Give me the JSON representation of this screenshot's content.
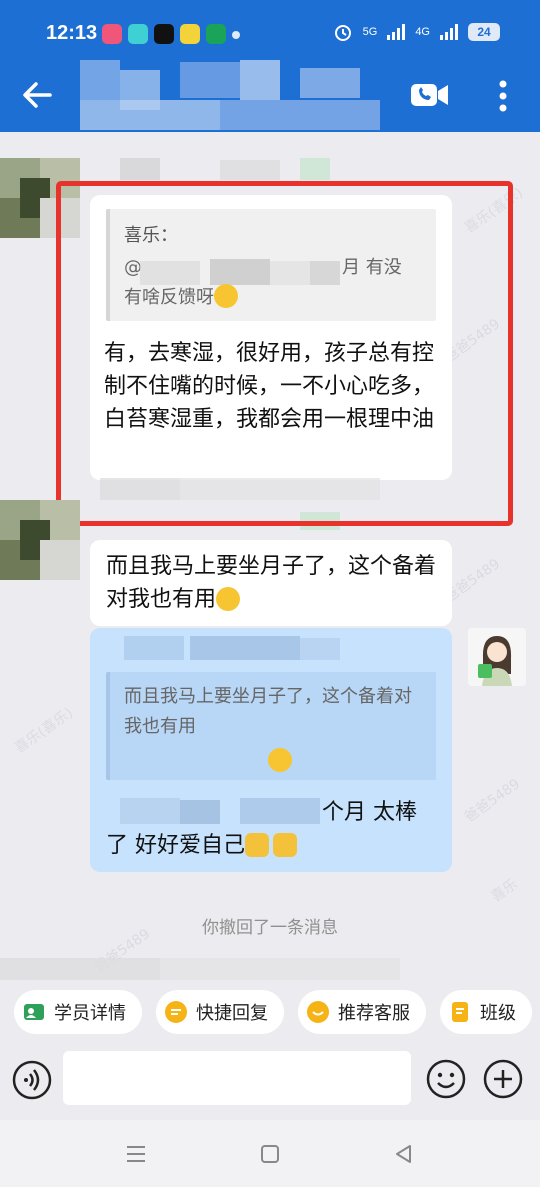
{
  "status_bar": {
    "time": "12:13",
    "net_1": "5G",
    "net_2": "4G",
    "battery": "24"
  },
  "chat": {
    "msg1": {
      "quote_name": "喜乐：",
      "quote_line1_prefix": "@",
      "quote_line1_suffix": "月 有没",
      "quote_line2": "有啥反馈呀",
      "text": "有，去寒湿，很好用，孩子总有控制不住嘴的时候，一不小心吃多，白苔寒湿重，我都会用一根理中油"
    },
    "msg2": {
      "text": "而且我马上要坐月子了，这个备着对我也有用"
    },
    "msg3": {
      "quote_text": "而且我马上要坐月子了，这个备着对我也有用",
      "text_line1_suffix": "个月 太棒",
      "text_line2": "了  好好爱自己"
    },
    "system": "你撤回了一条消息"
  },
  "quick_actions": [
    {
      "label": "学员详情",
      "icon": "person-card-icon",
      "color": "#2fa05a"
    },
    {
      "label": "快捷回复",
      "icon": "quick-reply-icon",
      "color": "#f5b316"
    },
    {
      "label": "推荐客服",
      "icon": "recommend-service-icon",
      "color": "#f5b316"
    },
    {
      "label": "班级",
      "icon": "class-icon",
      "color": "#f5b316"
    }
  ],
  "watermarks": [
    "喜乐(喜乐)",
    "爸爸5489",
    "喜乐(喜乐)",
    "爸爸5489",
    "爸爸5489",
    "喜乐",
    "爸爸5489"
  ],
  "colors": {
    "header": "#1e6fd4",
    "highlight_box": "#e8322c",
    "my_bubble": "#c7e2fd"
  }
}
